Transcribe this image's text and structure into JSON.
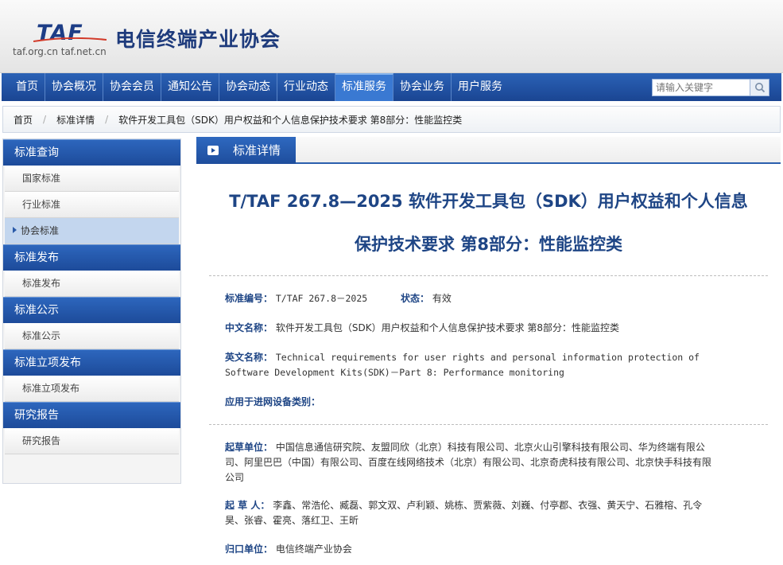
{
  "header": {
    "logo_text": "TAF",
    "logo_urls": "taf.org.cn  taf.net.cn",
    "site_title": "电信终端产业协会"
  },
  "nav": {
    "items": [
      {
        "label": "首页"
      },
      {
        "label": "协会概况"
      },
      {
        "label": "协会会员"
      },
      {
        "label": "通知公告"
      },
      {
        "label": "协会动态"
      },
      {
        "label": "行业动态"
      },
      {
        "label": "标准服务",
        "active": true
      },
      {
        "label": "协会业务"
      },
      {
        "label": "用户服务"
      }
    ],
    "search_placeholder": "请输入关键字"
  },
  "breadcrumb": {
    "home": "首页",
    "detail": "标准详情",
    "current": "软件开发工具包（SDK）用户权益和个人信息保护技术要求 第8部分：性能监控类"
  },
  "sidebar": {
    "sections": [
      {
        "title": "标准查询",
        "items": [
          "国家标准",
          "行业标准",
          "协会标准"
        ]
      },
      {
        "title": "标准发布",
        "items": [
          "标准发布"
        ]
      },
      {
        "title": "标准公示",
        "items": [
          "标准公示"
        ]
      },
      {
        "title": "标准立项发布",
        "items": [
          "标准立项发布"
        ]
      },
      {
        "title": "研究报告",
        "items": [
          "研究报告"
        ]
      }
    ],
    "active_item": "协会标准"
  },
  "main": {
    "tab_label": "标准详情",
    "title_line1": "T/TAF 267.8—2025 软件开发工具包（SDK）用户权益和个人信息",
    "title_line2": "保护技术要求 第8部分：性能监控类",
    "std_no_label": "标准编号：",
    "std_no": "T/TAF 267.8－2025",
    "status_label": "状态：",
    "status": "有效",
    "cn_name_label": "中文名称：",
    "cn_name": "软件开发工具包（SDK）用户权益和个人信息保护技术要求 第8部分：性能监控类",
    "en_name_label": "英文名称：",
    "en_name_line1": "Technical requirements for user rights and personal information protection of",
    "en_name_line2": "Software Development Kits(SDK)－Part 8: Performance monitoring",
    "device_label": "应用于进网设备类别：",
    "drafter_org_label": "起草单位：",
    "drafter_org_line1": "中国信息通信研究院、友盟同欣（北京）科技有限公司、北京火山引擎科技有限公司、华为终端有限公",
    "drafter_org_line2": "司、阿里巴巴（中国）有限公司、百度在线网络技术（北京）有限公司、北京奇虎科技有限公司、北京快手科技有限",
    "drafter_org_line3": "公司",
    "drafter_label": "起 草 人：",
    "drafter_line1": "李鑫、常浩伦、臧磊、郭文双、卢利颖、姚栋、贾紫薇、刘巍、付亭郡、衣强、黄天宁、石雅榕、孔令",
    "drafter_line2": "昊、张睿、霍亮、落红卫、王昕",
    "owner_label": "归口单位：",
    "owner": "电信终端产业协会"
  },
  "colors": {
    "nav_blue": "#1a4592",
    "title_blue": "#1e4585",
    "active_tab": "#3a79d2"
  }
}
